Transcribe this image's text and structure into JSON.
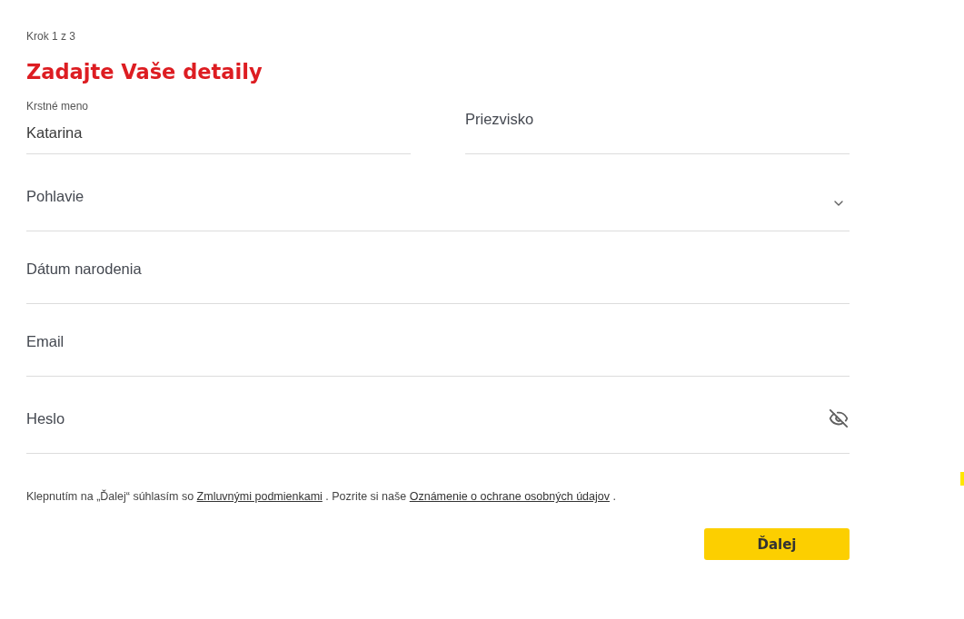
{
  "step": "Krok 1 z 3",
  "title": "Zadajte Vaše detaily",
  "name_fields": [
    {
      "kind": "text",
      "label": "Krstné meno",
      "value": "Katarina"
    },
    {
      "kind": "text",
      "placeholder": "Priezvisko"
    }
  ],
  "fields": [
    {
      "kind": "select",
      "placeholder": "Pohlavie"
    },
    {
      "kind": "text",
      "placeholder": "Dátum narodenia"
    },
    {
      "kind": "text",
      "placeholder": "Email"
    },
    {
      "kind": "password",
      "placeholder": "Heslo"
    }
  ],
  "consent": [
    {
      "kind": "text",
      "text": "Klepnutím na „Ďalej“ súhlasím so "
    },
    {
      "kind": "link",
      "text": "Zmluvnými podmienkami"
    },
    {
      "kind": "text",
      "text": " . Pozrite si naše "
    },
    {
      "kind": "link",
      "text": "Oznámenie o ochrane osobných údajov"
    },
    {
      "kind": "text",
      "text": " ."
    }
  ],
  "button": "Ďalej"
}
